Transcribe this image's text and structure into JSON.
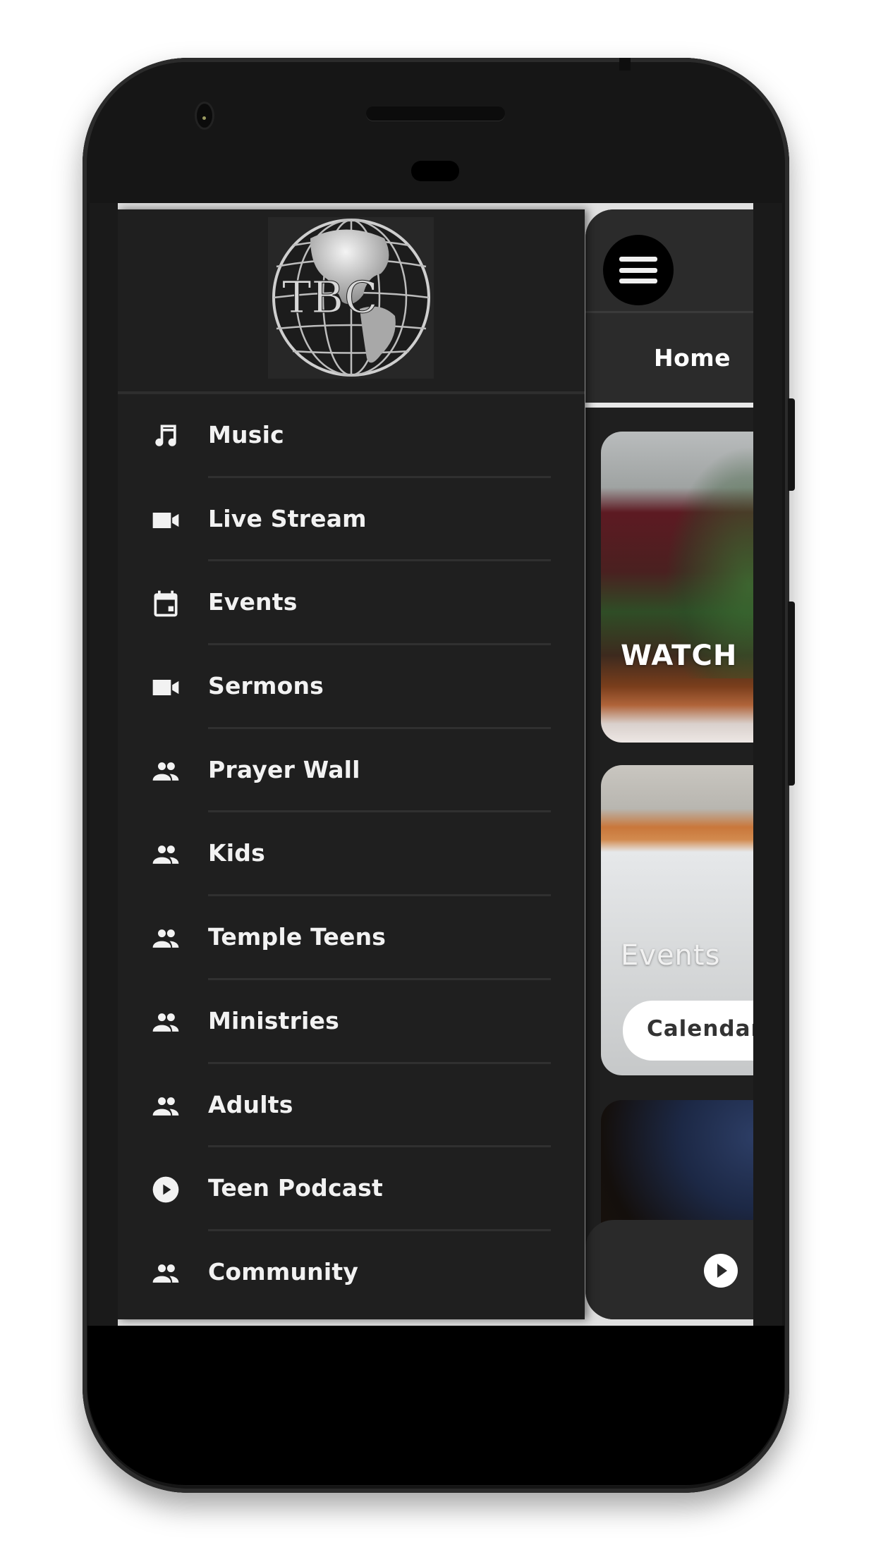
{
  "drawer": {
    "logo_text": "TBC",
    "items": [
      {
        "label": "Music",
        "icon": "music-note-icon"
      },
      {
        "label": "Live Stream",
        "icon": "video-camera-icon"
      },
      {
        "label": "Events",
        "icon": "calendar-icon"
      },
      {
        "label": "Sermons",
        "icon": "video-camera-icon"
      },
      {
        "label": "Prayer Wall",
        "icon": "people-icon"
      },
      {
        "label": "Kids",
        "icon": "people-icon"
      },
      {
        "label": "Temple Teens",
        "icon": "people-icon"
      },
      {
        "label": "Ministries",
        "icon": "people-icon"
      },
      {
        "label": "Adults",
        "icon": "people-icon"
      },
      {
        "label": "Teen Podcast",
        "icon": "play-circle-icon"
      },
      {
        "label": "Community",
        "icon": "people-icon"
      }
    ]
  },
  "main": {
    "menu_icon": "hamburger-menu-icon",
    "tabs": [
      {
        "label": "Home",
        "active": true
      }
    ],
    "cards": [
      {
        "label": "WATCH"
      },
      {
        "label": "Events",
        "button_label": "Calendar"
      },
      {
        "label": ""
      }
    ],
    "player": {
      "play_icon": "play-circle-icon"
    }
  },
  "colors": {
    "background": "#1f1f1f",
    "header": "#2b2b2b",
    "text": "#f2f2f2",
    "divider": "#303030",
    "accent": "#ffffff"
  }
}
